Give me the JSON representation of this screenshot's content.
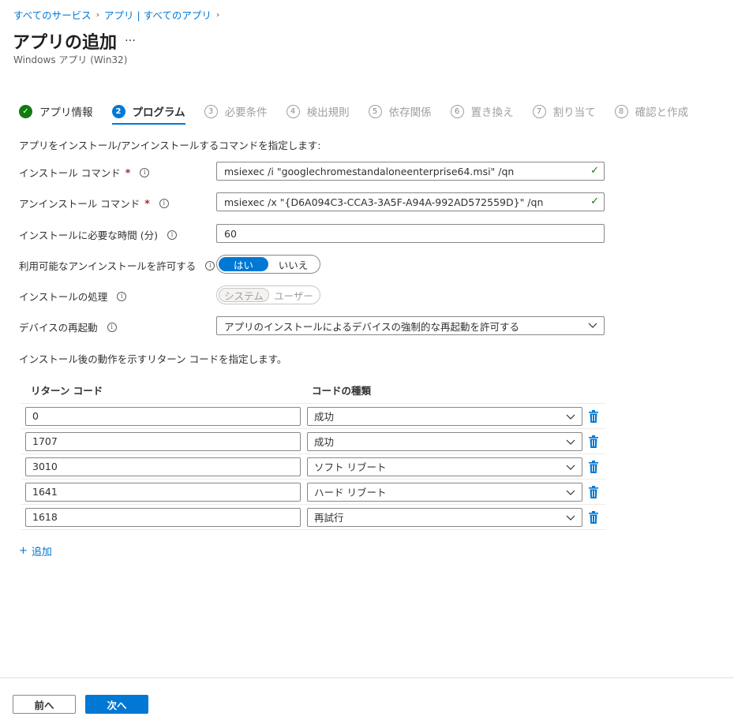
{
  "breadcrumb": {
    "items": [
      "すべてのサービス",
      "アプリ | すべてのアプリ"
    ],
    "separator": ">"
  },
  "page": {
    "title": "アプリの追加",
    "more": "…",
    "subtitle": "Windows アプリ (Win32)"
  },
  "wizard": {
    "steps": [
      {
        "num": "✓",
        "label": "アプリ情報",
        "state": "done"
      },
      {
        "num": "2",
        "label": "プログラム",
        "state": "active"
      },
      {
        "num": "3",
        "label": "必要条件",
        "state": "pending"
      },
      {
        "num": "4",
        "label": "検出規則",
        "state": "pending"
      },
      {
        "num": "5",
        "label": "依存関係",
        "state": "pending"
      },
      {
        "num": "6",
        "label": "置き換え",
        "state": "pending"
      },
      {
        "num": "7",
        "label": "割り当て",
        "state": "pending"
      },
      {
        "num": "8",
        "label": "確認と作成",
        "state": "pending"
      }
    ]
  },
  "form": {
    "description": "アプリをインストール/アンインストールするコマンドを指定します:",
    "install_cmd_label": "インストール コマンド",
    "install_cmd_value": "msiexec /i \"googlechromestandaloneenterprise64.msi\" /qn",
    "uninstall_cmd_label": "アンインストール コマンド",
    "uninstall_cmd_value": "msiexec /x \"{D6A094C3-CCA3-3A5F-A94A-992AD572559D}\" /qn",
    "install_time_label": "インストールに必要な時間 (分)",
    "install_time_value": "60",
    "allow_uninstall_label": "利用可能なアンインストールを許可する",
    "allow_uninstall_yes": "はい",
    "allow_uninstall_no": "いいえ",
    "install_behavior_label": "インストールの処理",
    "install_behavior_system": "システム",
    "install_behavior_user": "ユーザー",
    "restart_label": "デバイスの再起動",
    "restart_value": "アプリのインストールによるデバイスの強制的な再起動を許可する",
    "required_mark": "*",
    "info_glyph": "i"
  },
  "return_codes": {
    "description": "インストール後の動作を示すリターン コードを指定します。",
    "col_code": "リターン コード",
    "col_type": "コードの種類",
    "rows": [
      {
        "code": "0",
        "type": "成功"
      },
      {
        "code": "1707",
        "type": "成功"
      },
      {
        "code": "3010",
        "type": "ソフト リブート"
      },
      {
        "code": "1641",
        "type": "ハード リブート"
      },
      {
        "code": "1618",
        "type": "再試行"
      }
    ],
    "add_label": "追加"
  },
  "footer": {
    "prev_label": "前へ",
    "next_label": "次へ"
  },
  "colors": {
    "accent": "#0078d4",
    "success": "#107c10",
    "required": "#a4262c"
  }
}
